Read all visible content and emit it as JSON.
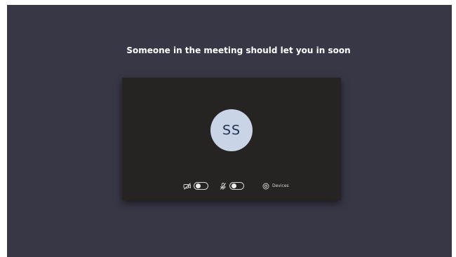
{
  "prejoin": {
    "message": "Someone in the meeting should let you in soon",
    "avatar_initials": "SS",
    "controls": {
      "camera": {
        "icon": "camera-off-icon",
        "state": "off"
      },
      "microphone": {
        "icon": "mic-off-icon",
        "state": "off"
      },
      "devices": {
        "icon": "gear-icon",
        "label": "Devices"
      }
    }
  },
  "colors": {
    "background": "#383746",
    "preview_background": "#252423",
    "avatar_background": "#c9d5e6",
    "avatar_text": "#20304f",
    "text": "#ffffff"
  }
}
